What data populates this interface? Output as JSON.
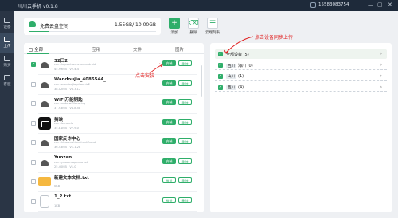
{
  "titlebar": {
    "title": "川川云手机 v0.1.8",
    "phone": "15583083754",
    "minimize": "—",
    "maximize": "▢",
    "close": "✕"
  },
  "sidebar": {
    "items": [
      {
        "label": "设备"
      },
      {
        "label": "上传",
        "active": true
      },
      {
        "label": "购买"
      },
      {
        "label": "客服"
      }
    ]
  },
  "storage": {
    "label": "免费云盘空间",
    "quota": "1.55GB/ 10.00GB",
    "used_fraction": 0.155
  },
  "tools": {
    "add": "添加",
    "delete": "删除",
    "cloud_file": "云端列表"
  },
  "tabs": {
    "all": "全部",
    "apps": "应用",
    "files": "文件",
    "images": "图片"
  },
  "rows": [
    {
      "name": "32口2",
      "pkg": "com.hapexi.launcher.android",
      "meta": "45.99MB  |  V2.4.4",
      "icon": "android",
      "checked": true,
      "buttons": [
        "安装",
        "删除"
      ]
    },
    {
      "name": "Wandoujia_4085544_...",
      "pkg": "com.wandoujia.phoenix2",
      "meta": "38.02MB  |  V8.3.12",
      "icon": "android",
      "checked": false,
      "buttons": [
        "安装",
        "删除"
      ]
    },
    {
      "name": "WiFi万能钥匙",
      "pkg": "com.snda.wifilocating",
      "meta": "37.93MB  |  V4.8.58",
      "icon": "android",
      "checked": false,
      "buttons": [
        "安装",
        "删除"
      ]
    },
    {
      "name": "剪映",
      "pkg": "com.lemon.lv",
      "meta": "35.81MB  |  V7.9.0",
      "icon": "capcut",
      "checked": false,
      "buttons": [
        "安装",
        "删除"
      ]
    },
    {
      "name": "国家反诈中心",
      "pkg": "com.hicorenational.antifraud",
      "meta": "36.43MB  |  V1.1.28",
      "icon": "android",
      "checked": false,
      "buttons": [
        "安装",
        "删除"
      ]
    },
    {
      "name": "Yuozan",
      "pkg": "com.yuozan.appmarket",
      "meta": "25.40MB  |  V1.0",
      "icon": "android",
      "checked": false,
      "buttons": [
        "安装",
        "删除"
      ]
    },
    {
      "name": "新建文本文档.txt",
      "pkg": "",
      "meta": "0KB",
      "icon": "folder",
      "checked": false,
      "buttons": [
        "推送",
        "删除"
      ]
    },
    {
      "name": "1_2.txt",
      "pkg": "",
      "meta": "1KB",
      "icon": "file",
      "checked": false,
      "buttons": [
        "推送",
        "删除"
      ]
    }
  ],
  "groups": [
    {
      "parts": [
        "全部设备",
        "(5)"
      ]
    },
    {
      "tag": "西川",
      "parts": [
        "海川",
        "(0)"
      ]
    },
    {
      "tag": "山川",
      "parts": [
        "(1)"
      ]
    },
    {
      "tag": "西川",
      "parts": [
        "(4)"
      ]
    }
  ],
  "callouts": {
    "upload": "点击设备同步上传",
    "install": "点击安装"
  },
  "colors": {
    "accent": "#2fae6a",
    "titlebar": "#1e2a3a",
    "sidebar": "#2a3545",
    "callout": "#e02020"
  }
}
